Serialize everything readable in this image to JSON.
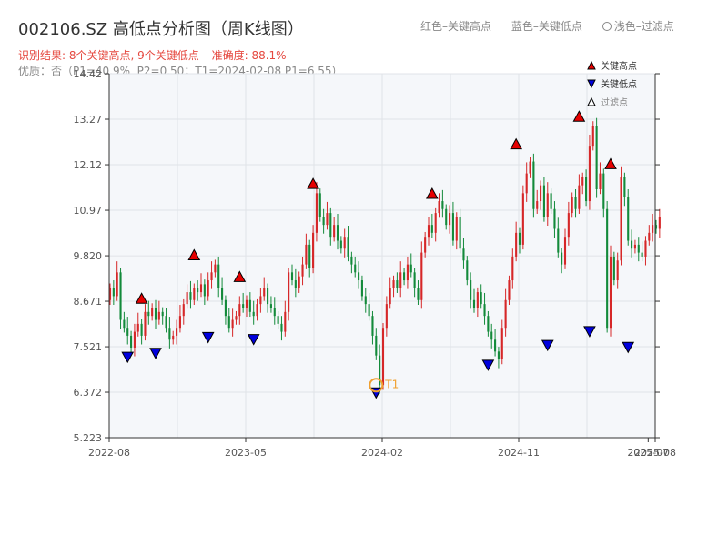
{
  "header": {
    "title": "002106.SZ 高低点分析图（周K线图）",
    "legend_red": "红色–关键高点",
    "legend_blue": "蓝色–关键低点",
    "legend_light": "浅色–过滤点",
    "result_prefix": "识别结果: 8个关键高点, 9个关键低点",
    "accuracy": "准确度: 88.1%",
    "quality": "优质：否（P1=40.9%, P2=0.50；T1=2024-02-08 P1=6.55）"
  },
  "colors": {
    "up": "#d62728",
    "down": "#138a3a",
    "high_marker": "#e60000",
    "low_marker": "#0000dd",
    "t1_ring": "#f0a030",
    "plot_bg": "#f5f7fa",
    "grid": "#e0e3e8"
  },
  "chart_data": {
    "type": "candlestick",
    "title": "002106.SZ 高低点分析图（周K线图）",
    "ylim": [
      5.223,
      14.42
    ],
    "y_ticks": [
      "5.223",
      "6.372",
      "7.521",
      "8.671",
      "9.820",
      "10.97",
      "12.12",
      "13.27",
      "14.42"
    ],
    "x_ticks": [
      {
        "date": "2022-08",
        "week": 0
      },
      {
        "date": "2023-05",
        "week": 39
      },
      {
        "date": "2024-02",
        "week": 78
      },
      {
        "date": "2024-11",
        "week": 117
      },
      {
        "date": "2025-07",
        "week": 154
      },
      {
        "date": "2025-08",
        "week": 156
      }
    ],
    "legend": [
      "关键高点",
      "关键低点",
      "过滤点"
    ],
    "legend_position": "top-right",
    "grid": true,
    "closes": [
      9.0,
      8.8,
      9.4,
      8.2,
      8.0,
      7.8,
      7.5,
      7.9,
      8.1,
      7.8,
      8.4,
      8.3,
      8.5,
      8.2,
      8.4,
      8.3,
      8.0,
      7.7,
      7.8,
      8.0,
      8.3,
      8.6,
      8.9,
      8.7,
      9.0,
      8.9,
      9.1,
      8.8,
      9.2,
      9.4,
      9.6,
      9.0,
      8.7,
      8.3,
      8.0,
      8.2,
      8.3,
      8.6,
      8.5,
      8.7,
      8.4,
      8.3,
      8.6,
      8.8,
      9.0,
      8.6,
      8.5,
      8.3,
      8.1,
      7.9,
      8.4,
      9.4,
      9.2,
      9.0,
      9.3,
      9.6,
      10.1,
      9.5,
      10.4,
      11.4,
      10.8,
      10.6,
      10.9,
      10.3,
      10.6,
      10.2,
      10.0,
      10.3,
      9.8,
      9.6,
      9.4,
      9.2,
      8.8,
      8.6,
      8.3,
      7.8,
      7.3,
      6.55,
      8.0,
      8.6,
      9.0,
      9.2,
      9.0,
      9.4,
      9.2,
      9.6,
      9.4,
      9.0,
      8.7,
      9.9,
      10.3,
      10.6,
      10.4,
      10.9,
      11.2,
      11.0,
      10.6,
      10.9,
      10.2,
      10.8,
      10.0,
      9.7,
      9.2,
      8.7,
      8.5,
      8.9,
      8.6,
      8.3,
      7.9,
      7.7,
      7.4,
      7.2,
      8.0,
      8.7,
      9.2,
      9.8,
      10.4,
      10.1,
      11.4,
      11.9,
      12.2,
      11.0,
      11.2,
      11.6,
      10.8,
      11.4,
      11.0,
      10.5,
      9.9,
      9.6,
      10.3,
      10.9,
      11.3,
      11.0,
      11.6,
      11.8,
      11.2,
      12.6,
      13.1,
      11.5,
      11.9,
      11.0,
      8.0,
      9.8,
      9.2,
      9.7,
      11.8,
      11.3,
      10.2,
      10.0,
      10.1,
      9.9,
      9.8,
      10.2,
      10.4,
      10.6,
      10.5,
      10.8
    ],
    "key_highs": [
      {
        "week": 9,
        "value": 8.55
      },
      {
        "week": 24,
        "value": 9.65
      },
      {
        "week": 37,
        "value": 9.1
      },
      {
        "week": 58,
        "value": 11.45
      },
      {
        "week": 92,
        "value": 11.2
      },
      {
        "week": 116,
        "value": 12.45
      },
      {
        "week": 134,
        "value": 13.15
      },
      {
        "week": 143,
        "value": 11.95
      }
    ],
    "key_lows": [
      {
        "week": 5,
        "value": 7.45
      },
      {
        "week": 13,
        "value": 7.55
      },
      {
        "week": 28,
        "value": 7.95
      },
      {
        "week": 41,
        "value": 7.9
      },
      {
        "week": 76,
        "value": 6.55
      },
      {
        "week": 108,
        "value": 7.25
      },
      {
        "week": 125,
        "value": 7.75
      },
      {
        "week": 137,
        "value": 8.1
      },
      {
        "week": 148,
        "value": 7.7
      }
    ],
    "t1": {
      "label": "T1",
      "week": 76,
      "value": 6.55
    }
  }
}
